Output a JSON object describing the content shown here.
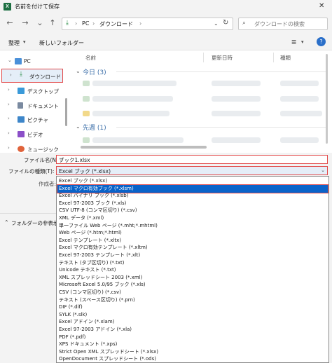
{
  "window": {
    "title": "名前を付けて保存",
    "app_icon": "excel-icon",
    "close_glyph": "✕"
  },
  "nav": {
    "back_glyph": "←",
    "forward_glyph": "→",
    "down_glyph": "⌄",
    "up_glyph": "↑",
    "address": [
      "PC",
      "ダウンロード"
    ],
    "address_dropdown": "⌄",
    "refresh_glyph": "↻",
    "search_placeholder": "ダウンロードの検索"
  },
  "toolbar": {
    "organize_label": "整理",
    "organize_chev": "▾",
    "new_folder_label": "新しいフォルダー",
    "view_glyph": "☰",
    "view_chev": "▾",
    "help_glyph": "?"
  },
  "sidebar": {
    "items": [
      {
        "label": "PC",
        "chev": "⌄",
        "icon": "pc-icon",
        "color": "#4a90d9"
      },
      {
        "label": "ダウンロード",
        "chev": "›",
        "icon": "download-icon",
        "color": "#2f8f4a"
      },
      {
        "label": "デスクトップ",
        "chev": "›",
        "icon": "desktop-icon",
        "color": "#3a9ad9"
      },
      {
        "label": "ドキュメント",
        "chev": "›",
        "icon": "documents-icon",
        "color": "#7a8aa0"
      },
      {
        "label": "ピクチャ",
        "chev": "›",
        "icon": "pictures-icon",
        "color": "#3d86c9"
      },
      {
        "label": "ビデオ",
        "chev": "›",
        "icon": "videos-icon",
        "color": "#8b4fc8"
      },
      {
        "label": "ミュージック",
        "chev": "›",
        "icon": "music-icon",
        "color": "#e0633b"
      }
    ]
  },
  "filelist": {
    "columns": [
      "名前",
      "更新日時",
      "種類"
    ],
    "groups": [
      {
        "label": "今日 (3)",
        "chev": "⌄"
      },
      {
        "label": "先週 (1)",
        "chev": "⌄"
      }
    ]
  },
  "form": {
    "filename_label": "ファイル名(N):",
    "filename_value": "ブック1.xlsx",
    "filetype_label": "ファイルの種類(T):",
    "filetype_value": "Excel ブック (*.xlsx)",
    "author_label": "作成者:",
    "hide_folders_label": "フォルダーの非表示",
    "hide_folders_glyph": "⌃",
    "dropdown_glyph": "⌄"
  },
  "dropdown": {
    "selected_index": 1,
    "options": [
      "Excel ブック (*.xlsx)",
      "Excel マクロ有効ブック (*.xlsm)",
      "Excel バイナリ ブック (*.xlsb)",
      "Excel 97-2003 ブック (*.xls)",
      "CSV UTF-8 (コンマ区切り) (*.csv)",
      "XML データ (*.xml)",
      "単一ファイル Web ページ (*.mht;*.mhtml)",
      "Web ページ (*.htm;*.html)",
      "Excel テンプレート (*.xltx)",
      "Excel マクロ有効テンプレート (*.xltm)",
      "Excel 97-2003 テンプレート (*.xlt)",
      "テキスト (タブ区切り) (*.txt)",
      "Unicode テキスト (*.txt)",
      "XML スプレッドシート 2003 (*.xml)",
      "Microsoft Excel 5.0/95 ブック (*.xls)",
      "CSV (コンマ区切り) (*.csv)",
      "テキスト (スペース区切り) (*.prn)",
      "DIF (*.dif)",
      "SYLK (*.slk)",
      "Excel アドイン (*.xlam)",
      "Excel 97-2003 アドイン (*.xla)",
      "PDF (*.pdf)",
      "XPS ドキュメント (*.xps)",
      "Strict Open XML スプレッドシート (*.xlsx)",
      "OpenDocument スプレッドシート (*.ods)"
    ]
  }
}
